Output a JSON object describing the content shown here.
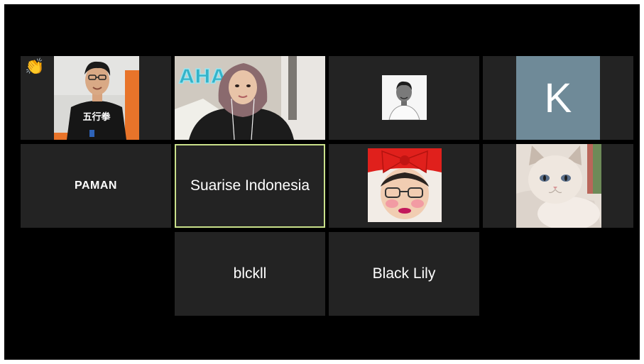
{
  "window_title": "",
  "participants": [
    {
      "id": "p1",
      "name": "",
      "reaction": "👏",
      "media": "video"
    },
    {
      "id": "p2",
      "name": "",
      "media": "video"
    },
    {
      "id": "p3",
      "name": "",
      "media": "profile-photo"
    },
    {
      "id": "p4",
      "name": "",
      "initial": "K",
      "media": "avatar-initial"
    },
    {
      "id": "p5",
      "name": "PAMAN",
      "media": "name-only"
    },
    {
      "id": "p6",
      "name": "Suarise Indonesia",
      "media": "name-only",
      "active_speaker": true
    },
    {
      "id": "p7",
      "name": "",
      "media": "profile-photo"
    },
    {
      "id": "p8",
      "name": "",
      "media": "profile-photo"
    },
    {
      "id": "p9",
      "name": "blckll",
      "media": "name-only"
    },
    {
      "id": "p10",
      "name": "Black Lily",
      "media": "name-only"
    }
  ],
  "colors": {
    "background": "#000000",
    "tile": "#232323",
    "active_border": "#c9e08a",
    "avatar_k": "#6f8a98"
  }
}
